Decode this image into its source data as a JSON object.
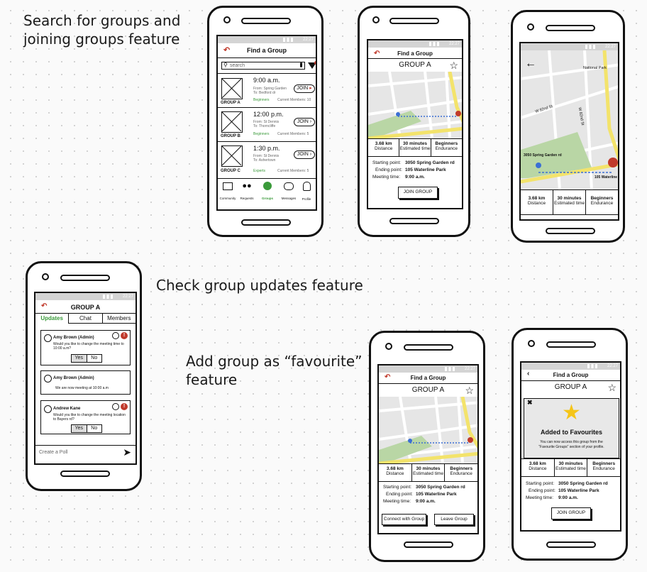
{
  "captions": {
    "search": "Search for groups and\njoining groups feature",
    "updates": "Check group updates feature",
    "favourite": "Add group as “favourite”\nfeature"
  },
  "status_time": "22:27",
  "colors": {
    "accent_green": "#3a9a3a",
    "accent_red": "#c0392b",
    "star": "#f5c518",
    "map_road": "#f3e36b",
    "park": "#b9d6a5"
  },
  "find": {
    "title": "Find a Group",
    "search_placeholder": "search",
    "groups": [
      {
        "time": "9:00 a.m.",
        "from": "From: Spring Garden",
        "to": "To: Bedford dr",
        "level": "Beginners",
        "members": "Current Members: 10",
        "name": "GROUP A",
        "join": "JOIN"
      },
      {
        "time": "12:00 p.m.",
        "from": "From: St Dennis",
        "to": "To: Thorncliffe",
        "level": "Beginners",
        "members": "Current Members: 5",
        "name": "GROUP B",
        "join": "JOIN"
      },
      {
        "time": "1:30 p.m.",
        "from": "From: St Dennis",
        "to": "To: Ashertown",
        "level": "Experts",
        "members": "Current Members: 5",
        "name": "GROUP C",
        "join": "JOIN"
      }
    ],
    "nav": [
      "Community",
      "Requests",
      "Groups",
      "Messages",
      "Profile"
    ]
  },
  "detail": {
    "title": "Find a Group",
    "group": "GROUP A",
    "stats": [
      {
        "value": "3.68 km",
        "label": "Distance"
      },
      {
        "value": "30 minutes",
        "label": "Estimated time"
      },
      {
        "value": "Beginners",
        "label": "Endurance"
      }
    ],
    "start_label": "Starting point:",
    "start_value": "3050 Spring Garden rd",
    "end_label": "Ending point:",
    "end_value": "105 Waterline Park",
    "time_label": "Meeting time:",
    "time_value": "9:00 a.m.",
    "join_button": "JOIN GROUP"
  },
  "map": {
    "park_label": "National Park",
    "street1": "W 82nd St",
    "street2": "W 82nd St",
    "start_label": "3050 Spring Garden rd",
    "end_label": "105 Waterline",
    "stats": [
      {
        "value": "3.68 km",
        "label": "Distance"
      },
      {
        "value": "30 minutes",
        "label": "Estimated time"
      },
      {
        "value": "Beginners",
        "label": "Endurance"
      }
    ]
  },
  "updates": {
    "title": "GROUP A",
    "tabs": [
      "Updates",
      "Chat",
      "Members"
    ],
    "posts": [
      {
        "author": "Amy Brown (Admin)",
        "text": "Would you like to change the meeting time to 10:00 a.m?",
        "yes": "Yes",
        "no": "No"
      },
      {
        "author": "Amy Brown (Admin)",
        "text": "We are now meeting at 10:00 a.m"
      },
      {
        "author": "Andrew Kane",
        "text": "Would you like to change the meeting location to Bayers rd?",
        "yes": "Yes",
        "no": "No"
      }
    ],
    "poll_placeholder": "Create a Poll"
  },
  "joined": {
    "title": "Find a Group",
    "group": "GROUP A",
    "stats": [
      {
        "value": "3.68 km",
        "label": "Distance"
      },
      {
        "value": "30 minutes",
        "label": "Estimated time"
      },
      {
        "value": "Beginners",
        "label": "Endurance"
      }
    ],
    "start_label": "Starting point:",
    "start_value": "3050 Spring Garden rd",
    "end_label": "Ending point:",
    "end_value": "105 Waterline Park",
    "time_label": "Meeting time:",
    "time_value": "9:00 a.m.",
    "connect_button": "Connect with Group",
    "leave_button": "Leave Group"
  },
  "fav": {
    "title": "Find a Group",
    "group": "GROUP A",
    "modal_title": "Added to Favourites",
    "modal_text1": "You can now access this group from the",
    "modal_text2": "“Favourite Groups” section of your profile.",
    "stats": [
      {
        "value": "3.68 km",
        "label": "Distance"
      },
      {
        "value": "30 minutes",
        "label": "Estimated time"
      },
      {
        "value": "Beginners",
        "label": "Endurance"
      }
    ],
    "start_label": "Starting point:",
    "start_value": "3050 Spring Garden rd",
    "end_label": "Ending point:",
    "end_value": "105 Waterline Park",
    "time_label": "Meeting time:",
    "time_value": "9:00 a.m.",
    "join_button": "JOIN GROUP"
  }
}
